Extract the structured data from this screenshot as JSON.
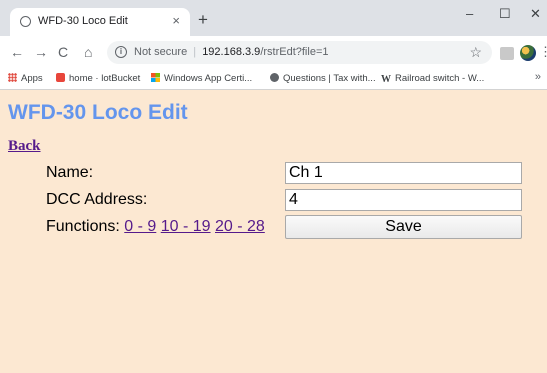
{
  "browser": {
    "tab_title": "WFD-30 Loco Edit",
    "tab_close": "×",
    "new_tab": "+",
    "window_controls": {
      "minimize": "–",
      "maximize": "☐",
      "close": "✕"
    },
    "nav": {
      "back": "←",
      "forward": "→",
      "reload": "C",
      "home": "⌂"
    },
    "security_label": "Not secure",
    "separator": "|",
    "url_host": "192.168.3.9",
    "url_path": "/rstrEdt?file=1",
    "star": "☆",
    "menu": "⋮",
    "bookmarks": [
      {
        "label": "Apps",
        "icon": "apps-grid-icon",
        "color": "#e04a3f"
      },
      {
        "label": "home · lotBucket",
        "icon": "lotbucket-icon",
        "color": "#e8463b"
      },
      {
        "label": "Windows App Certi...",
        "icon": "windows-icon",
        "color": "#00a4ef"
      },
      {
        "label": "Questions | Tax with...",
        "icon": "tax-icon",
        "color": "#5f6368"
      },
      {
        "label": "Railroad switch - W...",
        "icon": "wikipedia-icon",
        "color": "#202124"
      }
    ],
    "bookmarks_more": "»"
  },
  "page": {
    "title": "WFD-30 Loco Edit",
    "back_link": "Back",
    "name_label": "Name:",
    "name_value": "Ch 1",
    "dcc_label": "DCC Address:",
    "dcc_value": "4",
    "functions_label": "Functions:",
    "function_links": [
      "0 - 9",
      "10 - 19",
      "20 - 28"
    ],
    "save_label": "Save"
  },
  "colors": {
    "page_background": "#fce8d2",
    "title_color": "#6495ed",
    "link_color": "#551a8b"
  }
}
